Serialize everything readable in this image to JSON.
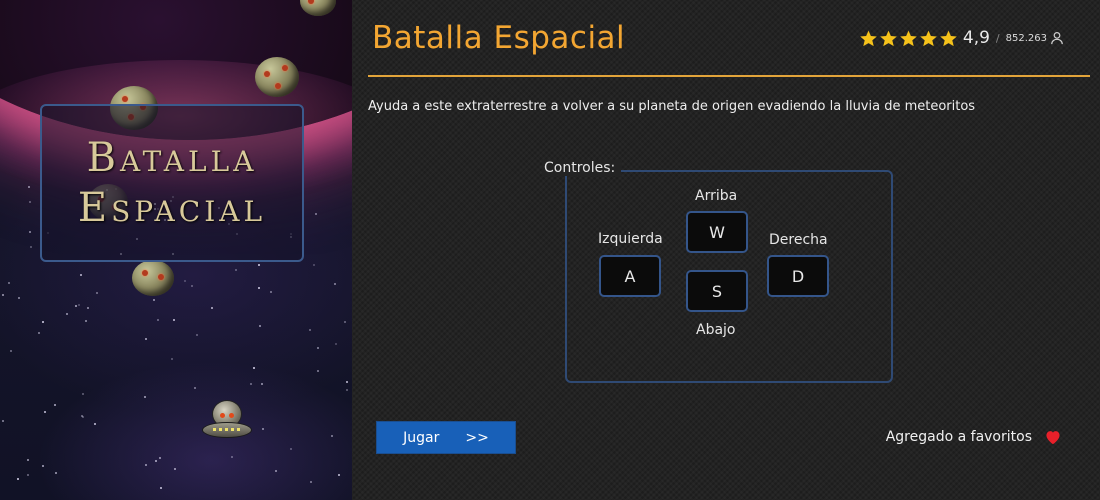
{
  "artwork": {
    "title_line1": "Batalla",
    "title_line2": "Espacial"
  },
  "header": {
    "title": "Batalla Espacial",
    "rating": {
      "stars": 5,
      "value": "4,9",
      "separator": "/",
      "count": "852.263"
    }
  },
  "description": "Ayuda a este extraterrestre a volver a su planeta de origen evadiendo la lluvia de meteoritos",
  "controls": {
    "label": "Controles:",
    "up_label": "Arriba",
    "up_key": "W",
    "left_label": "Izquierda",
    "left_key": "A",
    "right_label": "Derecha",
    "right_key": "D",
    "down_label": "Abajo",
    "down_key": "S"
  },
  "actions": {
    "play_label": "Jugar",
    "play_arrows": ">>",
    "favorites_label": "Agregado a favoritos"
  },
  "colors": {
    "accent_orange": "#f3a632",
    "star_yellow": "#f5c21b",
    "button_blue": "#1860b8",
    "heart_red": "#e8202a",
    "key_border": "#34558a"
  }
}
